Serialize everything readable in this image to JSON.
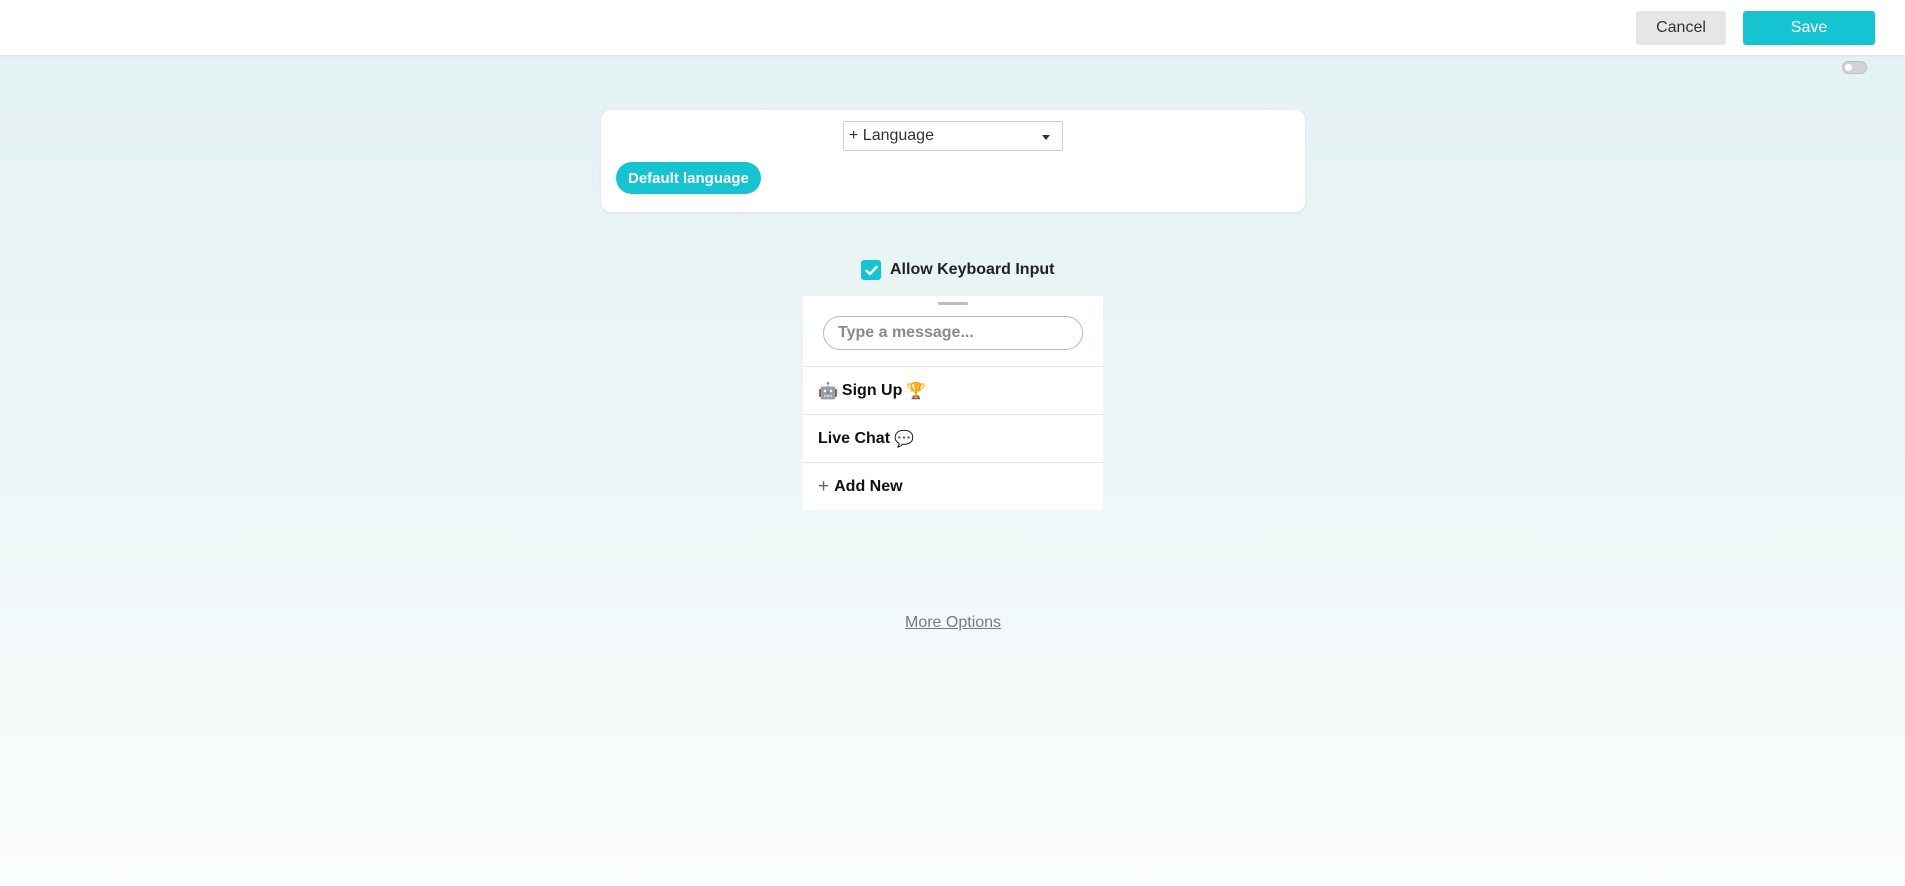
{
  "header": {
    "cancel_label": "Cancel",
    "save_label": "Save"
  },
  "colors": {
    "accent": "#15c3d1",
    "cancel_bg": "#e6e6e6"
  },
  "language_card": {
    "select_value": "+ Language",
    "default_language_label": "Default language"
  },
  "keyboard": {
    "label": "Allow Keyboard Input",
    "checked": true
  },
  "message_input": {
    "placeholder": "Type a message..."
  },
  "quick_replies": [
    {
      "prefix": "🤖",
      "label": "Sign Up",
      "suffix": "🏆"
    },
    {
      "prefix": "",
      "label": "Live Chat",
      "suffix": "💬"
    }
  ],
  "add_new_label": "Add New",
  "more_options_label": "More Options"
}
